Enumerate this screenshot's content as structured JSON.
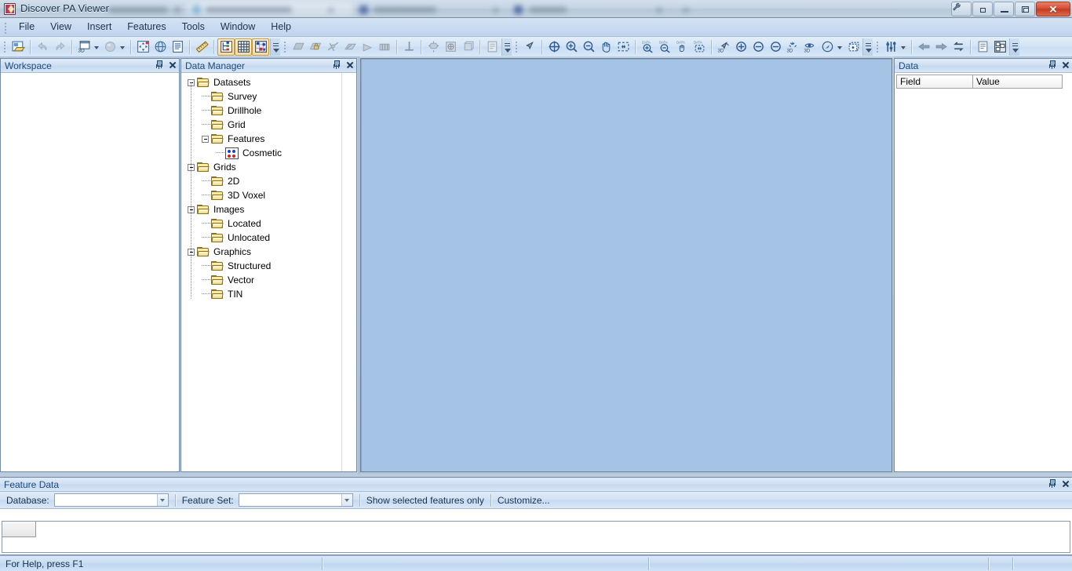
{
  "window": {
    "title": "Discover PA Viewer",
    "app_icon": "discover-app-icon",
    "controls": {
      "help_tool": "wrench-icon",
      "extra": "small-square-icon",
      "minimize": "minimize-icon",
      "restore": "restore-icon",
      "close": "close-icon"
    }
  },
  "menu": {
    "items": [
      {
        "label": "File"
      },
      {
        "label": "View"
      },
      {
        "label": "Insert"
      },
      {
        "label": "Features"
      },
      {
        "label": "Tools"
      },
      {
        "label": "Window"
      },
      {
        "label": "Help"
      }
    ]
  },
  "toolbar": {
    "groups": [
      {
        "name": "standard",
        "buttons": [
          {
            "icon": "open-project-icon",
            "state": "enabled"
          },
          {
            "sep": true
          },
          {
            "icon": "undo-icon",
            "state": "disabled"
          },
          {
            "icon": "redo-icon",
            "state": "disabled"
          },
          {
            "sep": true
          },
          {
            "icon": "new-3d-window-icon",
            "state": "enabled",
            "dropdown": true
          },
          {
            "icon": "sphere-icon",
            "state": "disabled",
            "dropdown": true
          },
          {
            "sep": true
          },
          {
            "icon": "move-object-icon",
            "state": "enabled"
          },
          {
            "icon": "globe-icon",
            "state": "enabled"
          },
          {
            "icon": "report-icon",
            "state": "enabled"
          },
          {
            "sep": true
          },
          {
            "icon": "ruler-icon",
            "state": "enabled"
          },
          {
            "sep": true
          },
          {
            "icon": "data-manager-icon",
            "state": "active"
          },
          {
            "icon": "grid-table-icon",
            "state": "active"
          },
          {
            "icon": "feature-data-icon",
            "state": "active"
          },
          {
            "overflow": true
          }
        ]
      },
      {
        "name": "drawing",
        "buttons": [
          {
            "icon": "polygon-icon",
            "state": "disabled"
          },
          {
            "icon": "locked-shape-icon",
            "state": "disabled"
          },
          {
            "icon": "section-line-icon",
            "state": "disabled"
          },
          {
            "icon": "fence-diagram-icon",
            "state": "disabled"
          },
          {
            "icon": "cone-icon",
            "state": "disabled"
          },
          {
            "icon": "drill-plan-icon",
            "state": "disabled"
          },
          {
            "sep": true
          },
          {
            "icon": "plan-view-icon",
            "state": "disabled"
          },
          {
            "sep": true
          },
          {
            "icon": "rotate-object-icon",
            "state": "disabled"
          },
          {
            "icon": "cube-rotate-icon",
            "state": "disabled"
          },
          {
            "icon": "cube-wireframe-icon",
            "state": "disabled"
          },
          {
            "sep": true
          },
          {
            "icon": "clipboard-icon",
            "state": "disabled"
          },
          {
            "overflow": true
          }
        ]
      },
      {
        "name": "navigation",
        "buttons": [
          {
            "icon": "select-arrow-icon",
            "state": "enabled"
          },
          {
            "sep": true
          },
          {
            "icon": "pan-center-icon",
            "state": "enabled"
          },
          {
            "icon": "zoom-in-icon",
            "state": "enabled"
          },
          {
            "icon": "zoom-out-icon",
            "state": "enabled"
          },
          {
            "icon": "hand-pan-icon",
            "state": "enabled"
          },
          {
            "icon": "zoom-extents-icon",
            "state": "enabled"
          },
          {
            "sep": true
          },
          {
            "icon": "data-zoom-in-icon",
            "state": "enabled"
          },
          {
            "icon": "data-zoom-out-icon",
            "state": "enabled"
          },
          {
            "icon": "data-pan-icon",
            "state": "enabled"
          },
          {
            "icon": "data-extents-icon",
            "state": "enabled"
          },
          {
            "sep": true
          },
          {
            "icon": "zoom-3d-icon",
            "state": "enabled"
          },
          {
            "icon": "zoom-in-plus-icon",
            "state": "enabled"
          },
          {
            "icon": "zoom-out-minus-icon",
            "state": "enabled"
          },
          {
            "icon": "zoom-out-minus2-icon",
            "state": "enabled"
          },
          {
            "icon": "reset-3d-icon",
            "state": "enabled"
          },
          {
            "icon": "eye-3d-icon",
            "state": "enabled"
          },
          {
            "icon": "compass-icon",
            "state": "enabled",
            "dropdown": true
          },
          {
            "icon": "bounding-box-icon",
            "state": "enabled"
          },
          {
            "overflow": true
          }
        ]
      },
      {
        "name": "view-tools",
        "buttons": [
          {
            "icon": "sliders-icon",
            "state": "enabled",
            "dropdown": true
          },
          {
            "sep": true
          },
          {
            "icon": "back-arrow-icon",
            "state": "enabled"
          },
          {
            "icon": "forward-arrow-icon",
            "state": "enabled"
          },
          {
            "icon": "swap-arrows-icon",
            "state": "enabled"
          },
          {
            "sep": true
          },
          {
            "icon": "notes-icon",
            "state": "enabled"
          },
          {
            "icon": "tile-windows-icon",
            "state": "enabled"
          },
          {
            "overflow": true
          }
        ]
      }
    ]
  },
  "workspace_panel": {
    "title": "Workspace",
    "pin": "pin-icon",
    "close": "close-icon"
  },
  "data_manager_panel": {
    "title": "Data Manager",
    "pin": "pin-icon",
    "close": "close-icon",
    "tree": [
      {
        "label": "Datasets",
        "level": 0,
        "icon": "folder-icon",
        "expander": "collapse",
        "last": false
      },
      {
        "label": "Survey",
        "level": 1,
        "icon": "folder-icon",
        "expander": "none",
        "last": false
      },
      {
        "label": "Drillhole",
        "level": 1,
        "icon": "folder-icon",
        "expander": "none",
        "last": false
      },
      {
        "label": "Grid",
        "level": 1,
        "icon": "folder-icon",
        "expander": "none",
        "last": false
      },
      {
        "label": "Features",
        "level": 1,
        "icon": "folder-icon",
        "expander": "collapse",
        "last": true
      },
      {
        "label": "Cosmetic",
        "level": 2,
        "icon": "cosmetic-icon",
        "expander": "none",
        "last": true
      },
      {
        "label": "Grids",
        "level": 0,
        "icon": "folder-icon",
        "expander": "collapse",
        "last": false
      },
      {
        "label": "2D",
        "level": 1,
        "icon": "folder-icon",
        "expander": "none",
        "last": false
      },
      {
        "label": "3D Voxel",
        "level": 1,
        "icon": "folder-icon",
        "expander": "none",
        "last": true
      },
      {
        "label": "Images",
        "level": 0,
        "icon": "folder-icon",
        "expander": "collapse",
        "last": false
      },
      {
        "label": "Located",
        "level": 1,
        "icon": "folder-icon",
        "expander": "none",
        "last": false
      },
      {
        "label": "Unlocated",
        "level": 1,
        "icon": "folder-icon",
        "expander": "none",
        "last": true
      },
      {
        "label": "Graphics",
        "level": 0,
        "icon": "folder-icon",
        "expander": "collapse",
        "last": true
      },
      {
        "label": "Structured",
        "level": 1,
        "icon": "folder-icon",
        "expander": "none",
        "last": false
      },
      {
        "label": "Vector",
        "level": 1,
        "icon": "folder-icon",
        "expander": "none",
        "last": false
      },
      {
        "label": "TIN",
        "level": 1,
        "icon": "folder-icon",
        "expander": "none",
        "last": true
      }
    ]
  },
  "viewport": {
    "name": "3d-view-canvas",
    "background_color": "#a5c3e5"
  },
  "data_panel": {
    "title": "Data",
    "pin": "pin-icon",
    "close": "close-icon",
    "columns": [
      "Field",
      "Value"
    ],
    "rows": []
  },
  "feature_data_panel": {
    "title": "Feature Data",
    "pin": "pin-icon",
    "close": "close-icon",
    "database_label": "Database:",
    "database_value": "",
    "feature_set_label": "Feature Set:",
    "feature_set_value": "",
    "show_selected_label": "Show selected features only",
    "customize_label": "Customize...",
    "grid_columns": [],
    "grid_rows": []
  },
  "status_bar": {
    "help_text": "For Help, press F1",
    "cells": [
      "",
      "",
      ""
    ]
  }
}
